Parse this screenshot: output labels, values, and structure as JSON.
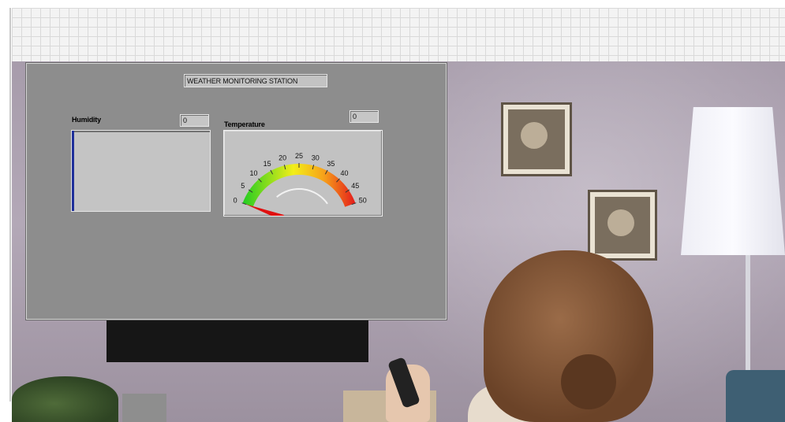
{
  "panel": {
    "title": "WEATHER MONITORING STATION",
    "humidity": {
      "label": "Humidity",
      "value": "0",
      "level_fraction": 1.0
    },
    "temperature": {
      "label": "Temperature",
      "value": "0",
      "scale": {
        "min": 0,
        "max": 50,
        "ticks": [
          "0",
          "5",
          "10",
          "15",
          "20",
          "25",
          "30",
          "35",
          "40",
          "45",
          "50"
        ]
      },
      "needle_value": 0,
      "colors": {
        "low": "#22cc22",
        "mid": "#f3ee18",
        "high": "#e31b1b",
        "needle": "#e01010"
      }
    }
  },
  "background": {
    "description_colors": {
      "grid": "#f3f3f3",
      "panel": "#8d8d8d",
      "display": "#c4c4c4",
      "humidity_fill": "#1f2f9a"
    }
  }
}
